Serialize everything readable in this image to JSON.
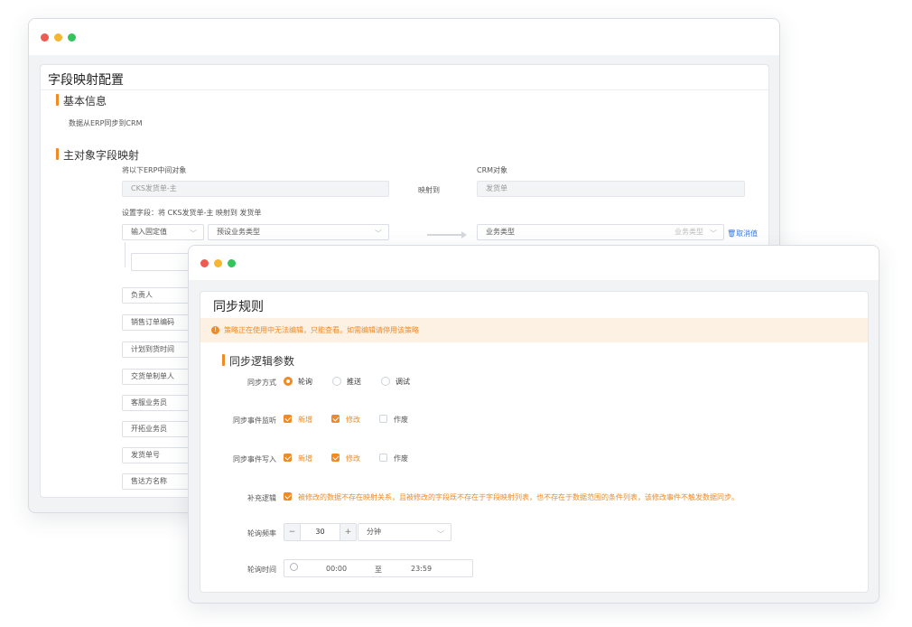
{
  "mapping_window": {
    "title": "字段映射配置",
    "basic_section": "基本信息",
    "basic_desc": "数据从ERP同步到CRM",
    "main_section": "主对象字段映射",
    "source_label": "将以下ERP中间对象",
    "source_value": "CKS发货单-主",
    "map_to": "映射到",
    "target_label": "CRM对象",
    "target_value": "发货单",
    "set_field_label": "设置字段：将 CKS发货单-主 映射到 发货单",
    "value_type": "输入固定值",
    "preset_field": "预设业务类型",
    "crm_field": "业务类型",
    "crm_field_hint": "业务类型",
    "cancel_value": "取消值",
    "field_rows": [
      "负责人",
      "销售订单编码",
      "计划到货时间",
      "交货单制单人",
      "客服业务员",
      "开拓业务员",
      "发货单号",
      "售达方名称"
    ]
  },
  "sync_window": {
    "title": "同步规则",
    "warning": "策略正在使用中无法编辑，只能查看。如需编辑请停用该策略",
    "section": "同步逻辑参数",
    "sync_mode": {
      "label": "同步方式",
      "options": [
        "轮询",
        "推送",
        "调试"
      ],
      "selected": "轮询"
    },
    "event_listen": {
      "label": "同步事件监听",
      "options": [
        {
          "text": "新增",
          "checked": true
        },
        {
          "text": "修改",
          "checked": true
        },
        {
          "text": "作废",
          "checked": false
        }
      ]
    },
    "event_write": {
      "label": "同步事件写入",
      "options": [
        {
          "text": "新增",
          "checked": true
        },
        {
          "text": "修改",
          "checked": true
        },
        {
          "text": "作废",
          "checked": false
        }
      ]
    },
    "supplement": {
      "label": "补充逻辑",
      "checked": true,
      "text": "被修改的数据不存在映射关系，且被修改的字段既不存在于字段映射列表，也不存在于数据范围的条件列表，该修改事件不触发数据同步。"
    },
    "poll_freq": {
      "label": "轮询频率",
      "minus": "−",
      "value": "30",
      "plus": "+",
      "unit": "分钟"
    },
    "poll_time": {
      "label": "轮询时间",
      "start": "00:00",
      "sep": "至",
      "end": "23:59"
    }
  },
  "colors": {
    "accent": "#f08a24",
    "link": "#3a7be0",
    "warning_bg": "#fdf1e3"
  }
}
